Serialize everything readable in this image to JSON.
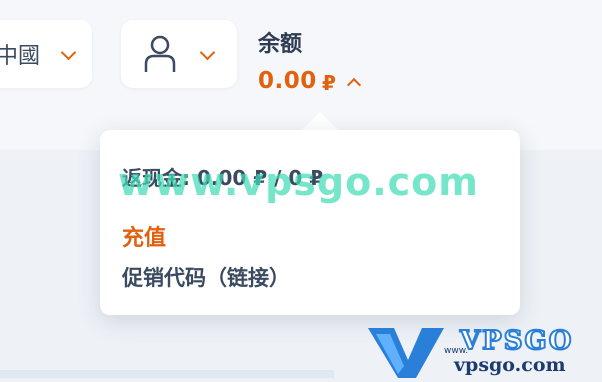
{
  "header": {
    "language": {
      "label": "中國"
    },
    "balance": {
      "title": "余额",
      "amount": "0.00",
      "currency": "₽"
    }
  },
  "balance_dropdown": {
    "cashback": "返现金: 0.00 ₽ / 0 ₽",
    "recharge_label": "充值",
    "promo_code_label": "促销代码（链接）"
  },
  "watermark": {
    "text": "www.vpsgo.com",
    "logo_brand": "VPSGO",
    "logo_www": "www.",
    "logo_url": "vpsgo.com"
  },
  "icons": {
    "language_dropdown": "chevron-down-icon",
    "user": "user-icon",
    "user_dropdown": "chevron-down-icon",
    "balance_toggle": "chevron-up-icon"
  },
  "colors": {
    "accent": "#e0620f",
    "text": "#2f3d52",
    "watermark": "#40dcb4",
    "logo_blue": "#2a7fd8"
  }
}
